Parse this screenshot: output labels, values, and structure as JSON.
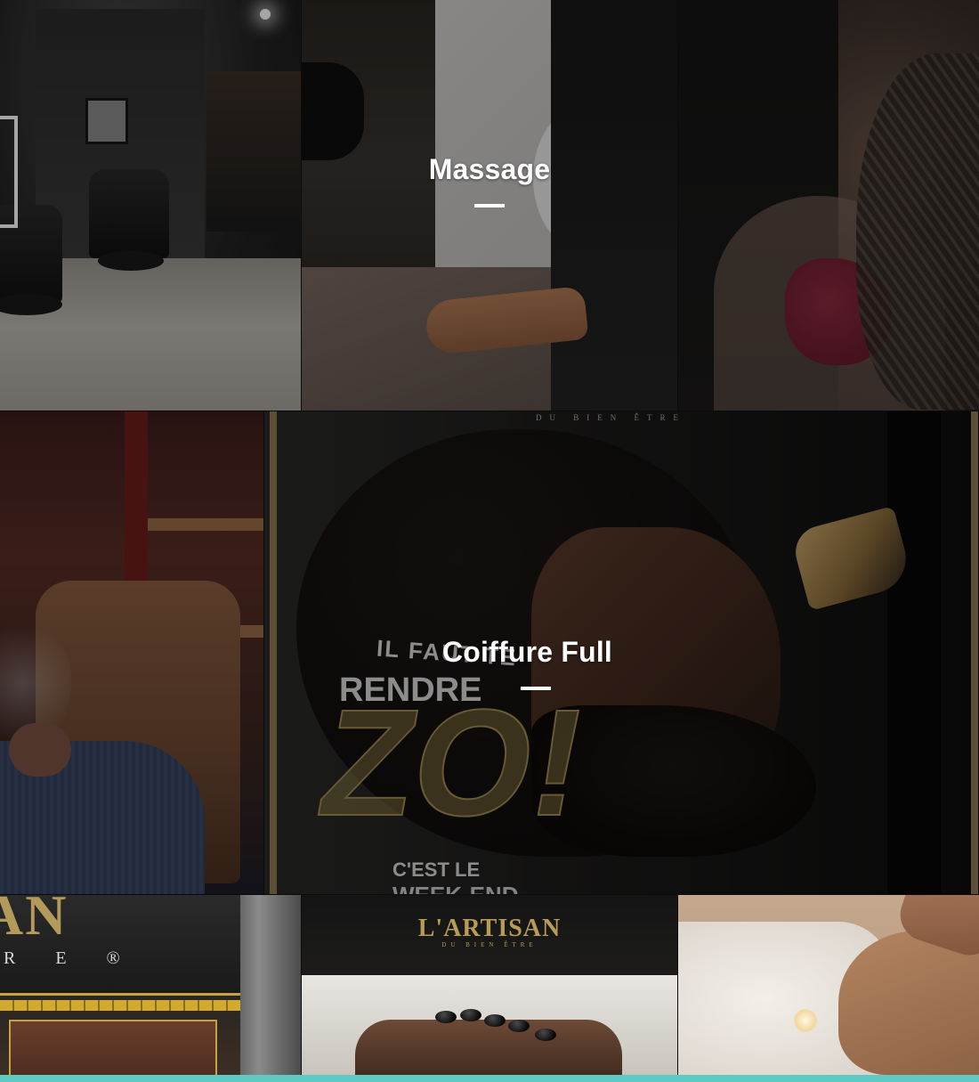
{
  "gallery": {
    "tiles": [
      {
        "id": "salon-interior",
        "title": ""
      },
      {
        "id": "massage",
        "title": "Massage"
      },
      {
        "id": "braids",
        "title": ""
      },
      {
        "id": "cigar-lounge",
        "title": ""
      },
      {
        "id": "coiffure-full",
        "title": "Coiffure Full",
        "poster": {
          "brand_line": "DU BIEN ÊTRE",
          "line1": "IL FAUT TE",
          "line2": "RENDRE",
          "big": "ZO!",
          "line3": "C'EST LE",
          "line4": "WEEK-END"
        }
      },
      {
        "id": "shop-front",
        "title": "",
        "sign": {
          "partial_name": "AN",
          "partial_sub": "R E ®"
        }
      },
      {
        "id": "hot-stones",
        "title": "",
        "logo": {
          "name": "L'ARTISAN",
          "sub": "DU BIEN ÊTRE"
        }
      },
      {
        "id": "spa-massage",
        "title": ""
      }
    ]
  },
  "theme": {
    "accent_border": "#5fc9c3",
    "gold": "#b79b57",
    "overlay_text": "#ffffff"
  }
}
